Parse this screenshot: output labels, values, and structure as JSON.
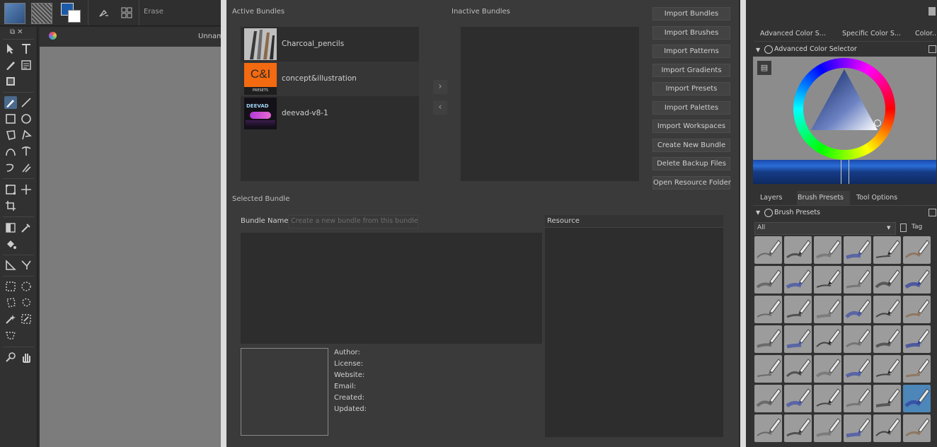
{
  "toolbar": {
    "brush_mode_label": "Erase"
  },
  "canvas": {
    "tab_title": "Unnam"
  },
  "bundle_manager": {
    "active_label": "Active Bundles",
    "inactive_label": "Inactive Bundles",
    "active_bundles": [
      {
        "name": "Charcoal_pencils"
      },
      {
        "name": "concept&illustration",
        "thumb_text": "C&I",
        "thumb_subtext": "PRESETS"
      },
      {
        "name": "deevad-v8-1",
        "thumb_text": "DEEVAD"
      }
    ],
    "buttons": [
      "Import Bundles",
      "Import Brushes",
      "Import Patterns",
      "Import Gradients",
      "Import Presets",
      "Import Palettes",
      "Import Workspaces",
      "Create New Bundle",
      "Delete Backup Files",
      "Open Resource Folder"
    ],
    "selected_bundle_label": "Selected Bundle",
    "bundle_name_label": "Bundle Name",
    "bundle_name_placeholder": "Create a new bundle from this bundle",
    "resource_label": "Resource",
    "meta": {
      "author": "Author:",
      "license": "License:",
      "website": "Website:",
      "email": "Email:",
      "created": "Created:",
      "updated": "Updated:"
    }
  },
  "right_dock": {
    "color_tabs": [
      "Advanced Color S...",
      "Specific Color S...",
      "Color..."
    ],
    "color_panel_title": "Advanced Color Selector",
    "lower_tabs": [
      "Layers",
      "Brush Presets",
      "Tool Options"
    ],
    "presets_panel_title": "Brush Presets",
    "tag_filter_value": "All",
    "tag_button_label": "Tag"
  }
}
